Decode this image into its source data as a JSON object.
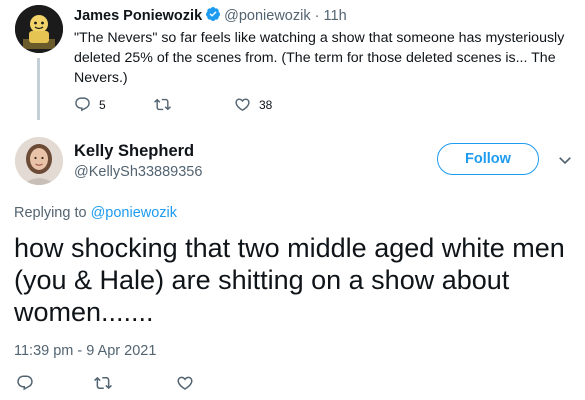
{
  "parent_tweet": {
    "name": "James Poniewozik",
    "handle": "@poniewozik",
    "separator": "·",
    "time": "11h",
    "text": "\"The Nevers\" so far feels like watching a show that someone has mysteriously deleted 25% of the scenes from. (The term for those deleted scenes is... The Nevers.)",
    "reply_count": "5",
    "like_count": "38"
  },
  "main_tweet": {
    "name": "Kelly Shepherd",
    "handle": "@KellySh33889356",
    "follow_label": "Follow",
    "replying_prefix": "Replying to",
    "replying_to": "@poniewozik",
    "text": "how shocking that two middle aged white men (you & Hale) are shitting on a show about women.......",
    "timestamp": "11:39 pm - 9 Apr 2021"
  },
  "colors": {
    "accent": "#1d9bf0",
    "secondary_text": "#536471",
    "primary_text": "#0f1419",
    "thread_line": "#c4cfd6"
  },
  "icons": [
    "reply-icon",
    "retweet-icon",
    "like-icon",
    "verified-icon",
    "chevron-down-icon"
  ]
}
